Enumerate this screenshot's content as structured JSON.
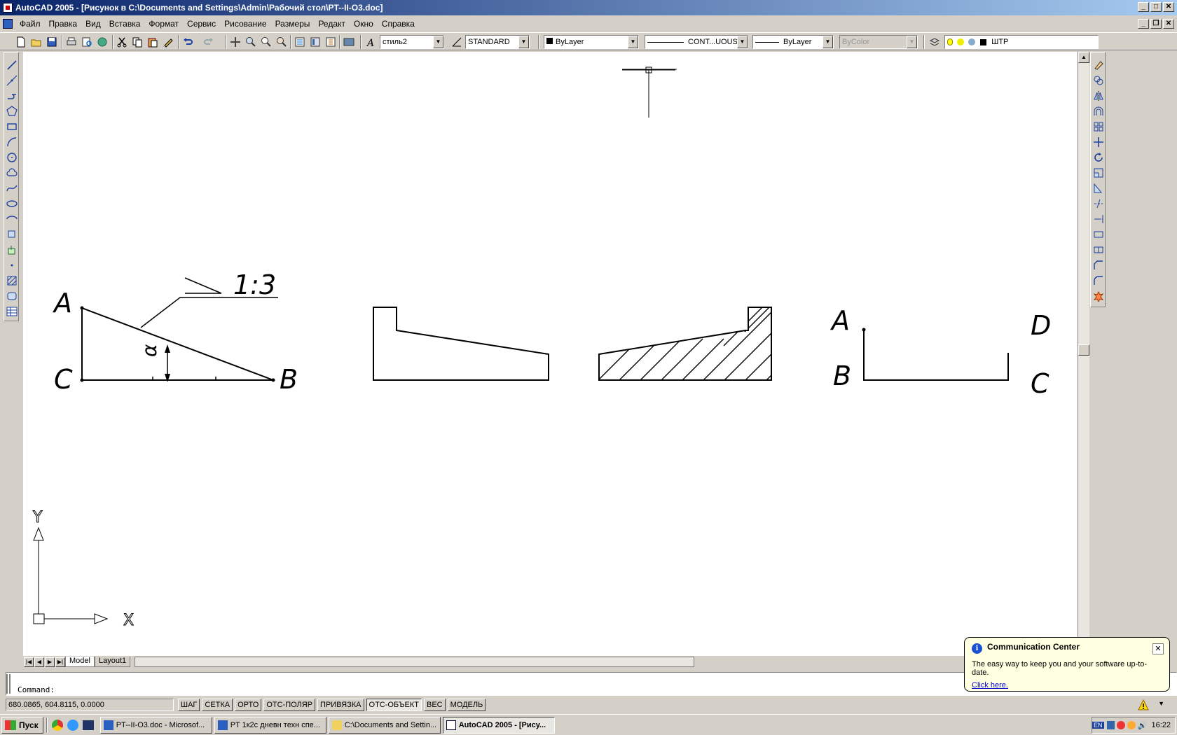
{
  "window": {
    "title": "AutoCAD 2005 - [Рисунок в C:\\Documents and Settings\\Admin\\Рабочий стол\\PT--II-O3.doc]",
    "minimize": "_",
    "maximize": "□",
    "close": "✕",
    "doc_minimize": "_",
    "doc_restore": "❐",
    "doc_close": "✕"
  },
  "menu": {
    "items": [
      "Файл",
      "Правка",
      "Вид",
      "Вставка",
      "Формат",
      "Сервис",
      "Рисование",
      "Размеры",
      "Редакт",
      "Окно",
      "Справка"
    ]
  },
  "toolbar": {
    "text_style": "стиль2",
    "dim_style": "STANDARD",
    "layer_color": "ByLayer",
    "linetype": "CONT...UOUS",
    "lineweight": "ByLayer",
    "plot_style": "ByColor",
    "layer_name": "ШТР"
  },
  "drawing": {
    "labels": {
      "tri_A": "A",
      "tri_C": "C",
      "tri_B": "B",
      "slope": "1:3",
      "alpha": "α",
      "right_A": "A",
      "right_D": "D",
      "right_B": "B",
      "right_C": "C"
    },
    "ucs": {
      "x_label": "X",
      "y_label": "Y"
    }
  },
  "tabs": {
    "items": [
      "Model",
      "Layout1"
    ],
    "active": "Model"
  },
  "command": {
    "prompt": "Command:"
  },
  "status": {
    "coords": "680.0865, 604.8115, 0.0000",
    "buttons": [
      "ШАГ",
      "СЕТКА",
      "ОРТО",
      "ОТС-ПОЛЯР",
      "ПРИВЯЗКА",
      "ОТС-ОБЪЕКТ",
      "ВЕС",
      "МОДЕЛЬ"
    ],
    "active": [
      "ОТС-ОБЪЕКТ"
    ]
  },
  "taskbar": {
    "start": "Пуск",
    "tasks": [
      "PT--II-O3.doc - Microsof...",
      "PT 1к2с дневн техн спе...",
      "C:\\Documents and Settin...",
      "AutoCAD 2005 - [Рису..."
    ],
    "active_task": "AutoCAD 2005 - [Рису...",
    "lang": "EN",
    "clock": "16:22"
  },
  "balloon": {
    "title": "Communication Center",
    "text": "The easy way to keep you and your software up-to-date.",
    "link": "Click here.",
    "close": "✕",
    "info": "i"
  }
}
